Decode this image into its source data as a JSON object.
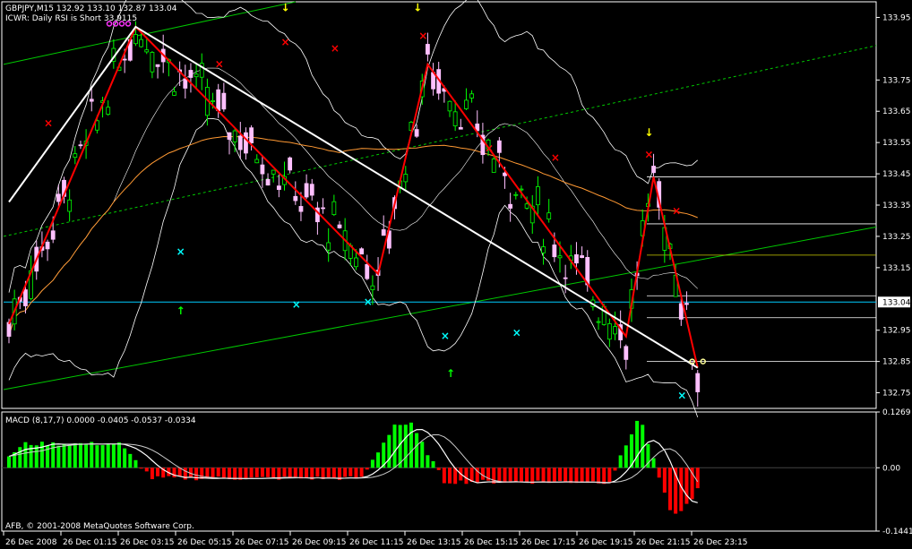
{
  "header": {
    "symbol_line": "GBPJPY,M15  132.92 133.10 132.87 133.04",
    "indicator_line": "ICWR: Daily RSI is Short 33.9115"
  },
  "macd": {
    "label": "MACD  (8,17,7) 0.0000 -0.0405 -0.0537 -0.0334",
    "copyright": "AFB, © 2001-2008 MetaQuotes Software Corp."
  },
  "colors": {
    "background": "#000000",
    "grid_border": "#ffffff",
    "bull_candle": "#00ff00",
    "bear_candle": "#ffc0ff",
    "zigzag": "#ff0000",
    "trend_white": "#ffffff",
    "channel_green": "#00c800",
    "macd_pos": "#00ff00",
    "macd_neg": "#ff0000",
    "current_price": "#00ccff",
    "buy_arrow": "#00ff00",
    "sell_arrow": "#ffff00",
    "cross_red": "#ff0000",
    "cross_cyan": "#00ffff"
  },
  "chart_data": [
    {
      "type": "candlestick",
      "title": "GBPJPY,M15",
      "y_ticks": [
        "133.95",
        "133.75",
        "133.65",
        "133.55",
        "133.45",
        "133.35",
        "133.25",
        "133.15",
        "133.04",
        "132.95",
        "132.85",
        "132.75"
      ],
      "ylim": [
        132.7,
        134.0
      ],
      "current_price": 133.04,
      "x_ticks": [
        "26 Dec 2008",
        "26 Dec 01:15",
        "26 Dec 03:15",
        "26 Dec 05:15",
        "26 Dec 07:15",
        "26 Dec 09:15",
        "26 Dec 11:15",
        "26 Dec 13:15",
        "26 Dec 15:15",
        "26 Dec 17:15",
        "26 Dec 19:15",
        "26 Dec 21:15",
        "26 Dec 23:15"
      ],
      "zigzag": [
        [
          0,
          132.97
        ],
        [
          23,
          133.92
        ],
        [
          67,
          133.13
        ],
        [
          76,
          133.8
        ],
        [
          112,
          132.93
        ],
        [
          117,
          133.44
        ],
        [
          125,
          132.83
        ]
      ],
      "fib_levels": [
        133.44,
        133.29,
        133.19,
        133.06,
        132.99,
        132.85
      ]
    },
    {
      "type": "bar",
      "title": "MACD (8,17,7)",
      "y_ticks": [
        "0.1269",
        "0.00",
        "-0.1441"
      ],
      "ylim": [
        -0.1441,
        0.1269
      ]
    }
  ]
}
